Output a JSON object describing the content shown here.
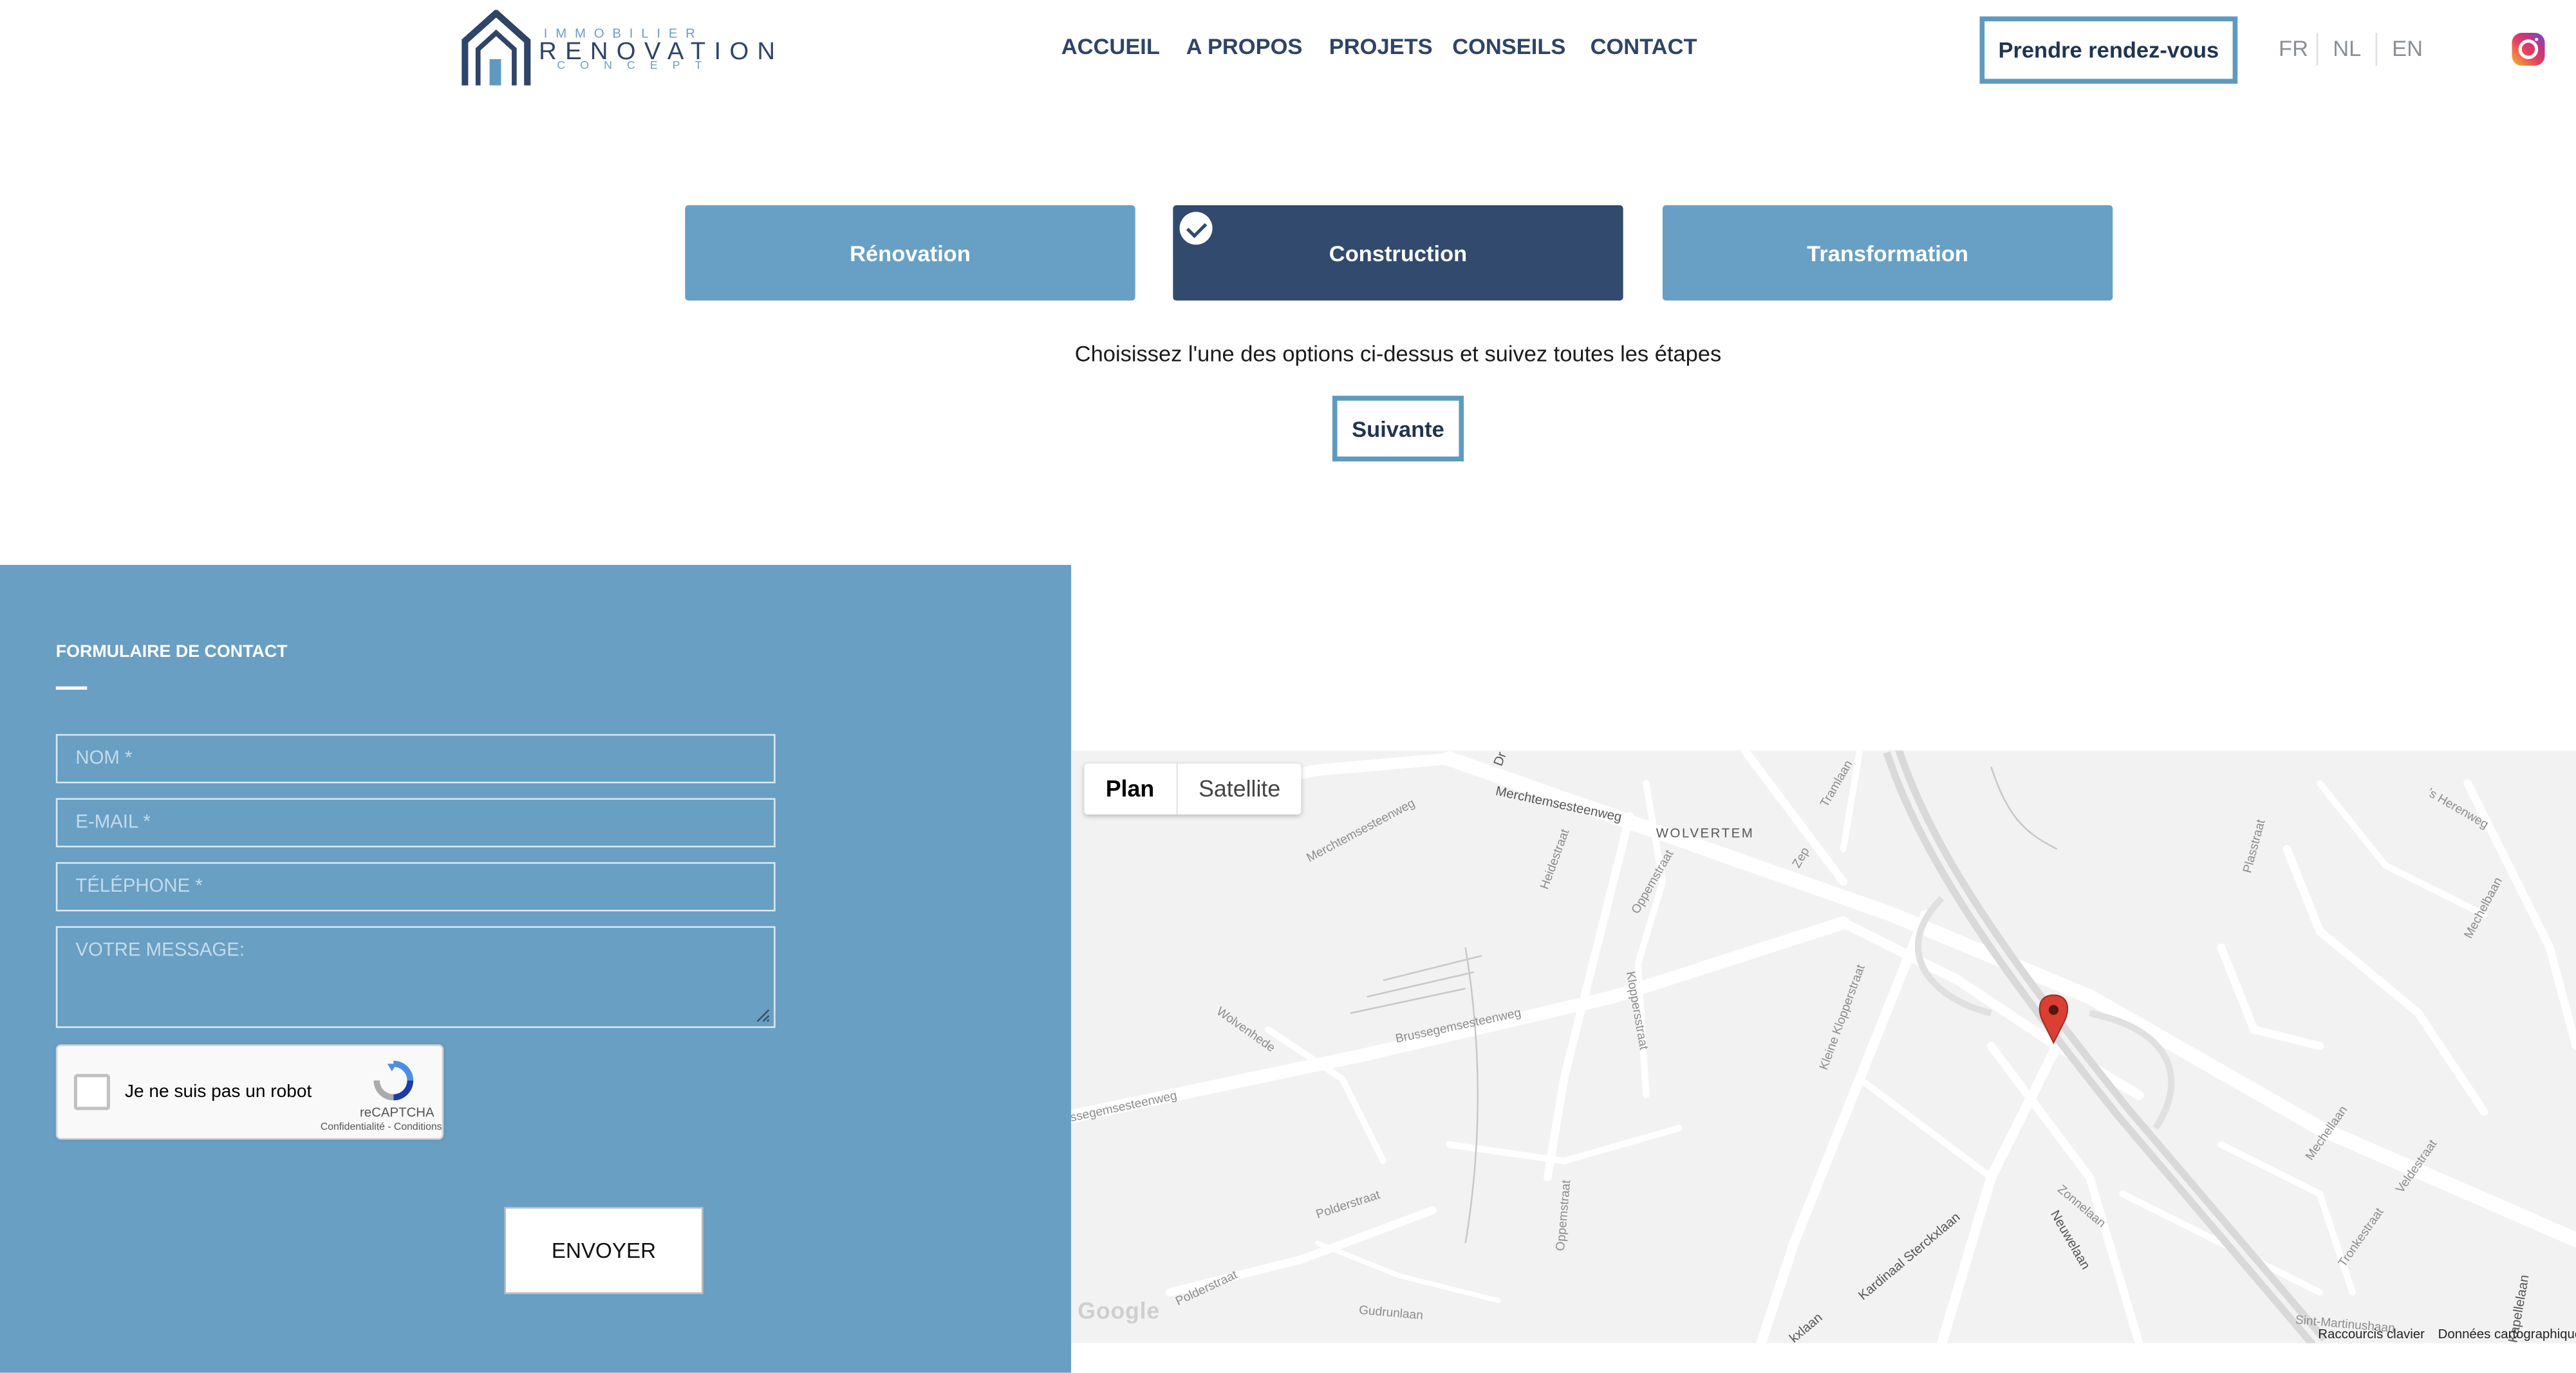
{
  "header": {
    "logo": {
      "top": "IMMOBILIER",
      "main": "RENOVATION",
      "sub": "CONCEPT"
    },
    "nav": [
      "ACCUEIL",
      "A PROPOS",
      "PROJETS",
      "CONSEILS",
      "CONTACT"
    ],
    "cta": "Prendre rendez-vous",
    "languages": [
      "FR",
      "NL",
      "EN"
    ]
  },
  "options": {
    "items": [
      {
        "label": "Rénovation",
        "selected": false
      },
      {
        "label": "Construction",
        "selected": true
      },
      {
        "label": "Transformation",
        "selected": false
      }
    ],
    "hint": "Choisissez l'une des options ci-dessus et suivez toutes les étapes",
    "next": "Suivante"
  },
  "contact": {
    "title": "FORMULAIRE DE CONTACT",
    "fields": {
      "name": "NOM *",
      "email": "E-MAIL *",
      "phone": "TÉLÉPHONE *",
      "message": "VOTRE MESSAGE:"
    },
    "captcha": {
      "label": "Je ne suis pas un robot",
      "brand": "reCAPTCHA",
      "terms": "Confidentialité - Conditions"
    },
    "submit": "ENVOYER",
    "panel_color": "#689fc3"
  },
  "map": {
    "toggle": {
      "plan": "Plan",
      "satellite": "Satellite"
    },
    "footer": {
      "shortcuts": "Raccourcis clavier",
      "data": "Données cartographiques"
    },
    "google": "Google",
    "labels": {
      "merchtem": "Merchtemsesteenweg",
      "merchtem2": "Merchtemsesteenweg",
      "wolvertem": "WOLVERTEM",
      "heidestraat": "Heidestraat",
      "oppemstraat": "Oppemstraat",
      "oppemstraat2": "Oppemstraat",
      "wolvenhede": "Wolvenhede",
      "brussegem": "Brussegemsesteenweg",
      "brussegem2": "ssegemsesteenweg",
      "kloppersstraat": "Kloppersstraat",
      "kleineklopper": "Kleine Klopperstraat",
      "polderstraat": "Polderstraat",
      "polderstraat2": "Polderstraat",
      "gudrunlaan": "Gudrunlaan",
      "kardinaal": "Kardinaal Sterckxlaan",
      "kxlaan": "kxlaan",
      "neuwelaan": "Neuwelaan",
      "zonnelaan": "Zonnelaan",
      "sintmartinus": "Sint-Martinushaan",
      "mechellaan": "Mechellaan",
      "veldestraat": "Veldestraat",
      "tronkestraat": "Tronkestraat",
      "plasstraat": "Plasstraat",
      "herenweg": "'s Herenweg",
      "mechelbaan": "Mechelbaan",
      "kapellelaan": "Kapellelaan",
      "tramlaan": "Tramlaan",
      "zep": "Zep",
      "dr": "Dr"
    }
  }
}
